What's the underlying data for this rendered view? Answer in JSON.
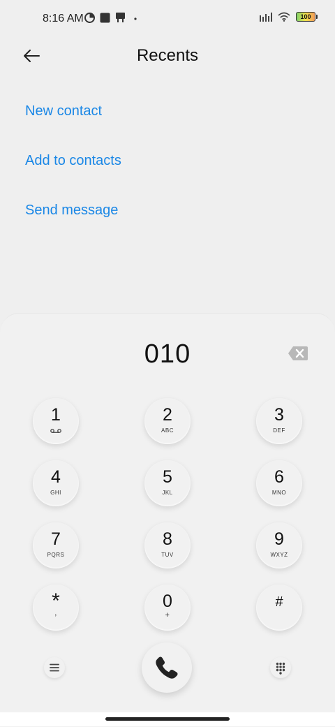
{
  "status_bar": {
    "time": "8:16 AM",
    "battery_level": "100",
    "icons": [
      "clock-icon",
      "square-notification-icon",
      "usb-icon",
      "dot-icon",
      "signal-icon",
      "wifi-icon",
      "battery-icon"
    ]
  },
  "header": {
    "title": "Recents",
    "back_icon": "arrow-left-icon"
  },
  "actions": {
    "new_contact": "New contact",
    "add_to_contacts": "Add to contacts",
    "send_message": "Send message"
  },
  "dialer": {
    "number": "010",
    "keys": [
      {
        "digit": "1",
        "letters": ""
      },
      {
        "digit": "2",
        "letters": "ABC"
      },
      {
        "digit": "3",
        "letters": "DEF"
      },
      {
        "digit": "4",
        "letters": "GHI"
      },
      {
        "digit": "5",
        "letters": "JKL"
      },
      {
        "digit": "6",
        "letters": "MNO"
      },
      {
        "digit": "7",
        "letters": "PQRS"
      },
      {
        "digit": "8",
        "letters": "TUV"
      },
      {
        "digit": "9",
        "letters": "WXYZ"
      },
      {
        "digit": "*",
        "letters": ","
      },
      {
        "digit": "0",
        "letters": "+"
      },
      {
        "digit": "#",
        "letters": ""
      }
    ]
  },
  "colors": {
    "accent": "#1a87e6",
    "background": "#efefef"
  }
}
